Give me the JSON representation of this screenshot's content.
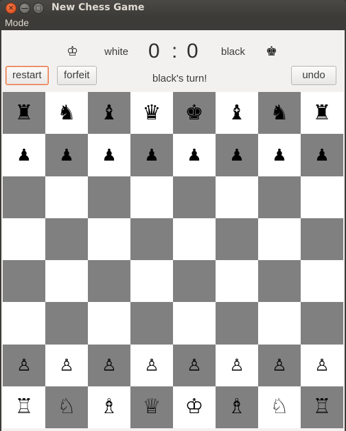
{
  "window": {
    "title": "New Chess Game",
    "close_glyph": "✕",
    "min_glyph": "—",
    "max_glyph": "□"
  },
  "menu": {
    "mode_label": "Mode"
  },
  "header": {
    "white_icon": "♔",
    "white_label": "white",
    "white_score": "0",
    "separator": ":",
    "black_score": "0",
    "black_label": "black",
    "black_icon": "♚"
  },
  "buttons": {
    "restart": "restart",
    "forfeit": "forfeit",
    "undo": "undo"
  },
  "status": "black's turn!",
  "board": {
    "dark_color": "#808080",
    "light_color": "#ffffff",
    "first_square_dark": true,
    "rows": [
      [
        "♜",
        "♞",
        "♝",
        "♛",
        "♚",
        "♝",
        "♞",
        "♜"
      ],
      [
        "♟",
        "♟",
        "♟",
        "♟",
        "♟",
        "♟",
        "♟",
        "♟"
      ],
      [
        "",
        "",
        "",
        "",
        "",
        "",
        "",
        ""
      ],
      [
        "",
        "",
        "",
        "",
        "",
        "",
        "",
        ""
      ],
      [
        "",
        "",
        "",
        "",
        "",
        "",
        "",
        ""
      ],
      [
        "",
        "",
        "",
        "",
        "",
        "",
        "",
        ""
      ],
      [
        "♙",
        "♙",
        "♙",
        "♙",
        "♙",
        "♙",
        "♙",
        "♙"
      ],
      [
        "♖",
        "♘",
        "♗",
        "♕",
        "♔",
        "♗",
        "♘",
        "♖"
      ]
    ]
  }
}
